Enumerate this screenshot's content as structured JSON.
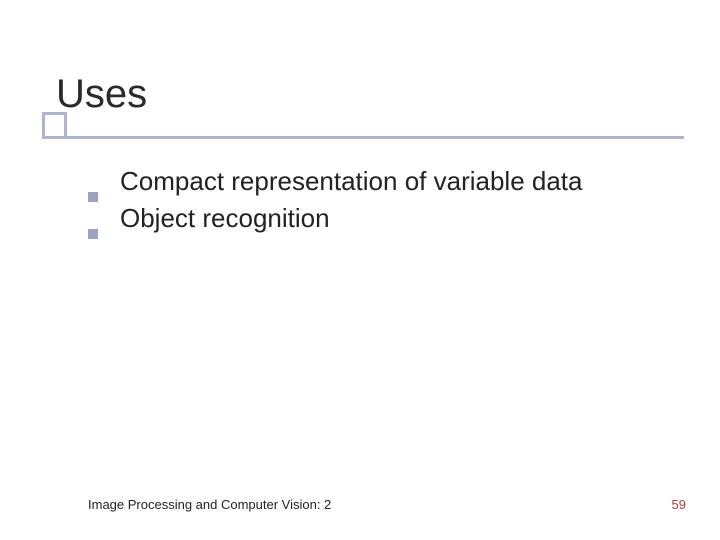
{
  "title": "Uses",
  "bullets": [
    {
      "text": "Compact representation of variable data"
    },
    {
      "text": "Object recognition"
    }
  ],
  "footer": {
    "left": "Image Processing and Computer Vision: 2",
    "page": "59"
  },
  "colors": {
    "accent": "#aeb4cc",
    "bullet": "#9ca3c0",
    "page_number": "#b23a3a"
  }
}
